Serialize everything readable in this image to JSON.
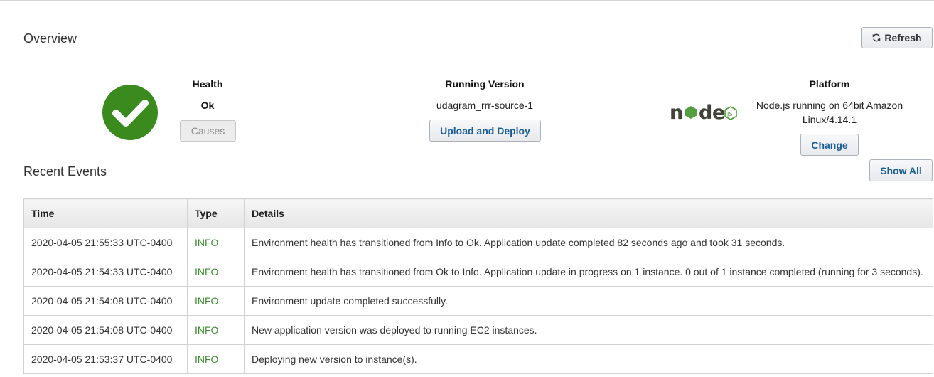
{
  "overview": {
    "title": "Overview",
    "refresh_label": "Refresh"
  },
  "health": {
    "heading": "Health",
    "status": "Ok",
    "causes_label": "Causes",
    "color": "#3b8a1e"
  },
  "running_version": {
    "heading": "Running Version",
    "value": "udagram_rrr-source-1",
    "upload_deploy_label": "Upload and Deploy"
  },
  "platform": {
    "heading": "Platform",
    "logo": "nodejs-logo",
    "description_line1": "Node.js running on 64bit Amazon",
    "description_line2": "Linux/4.14.1",
    "change_label": "Change"
  },
  "recent_events": {
    "title": "Recent Events",
    "show_all_label": "Show All",
    "columns": [
      "Time",
      "Type",
      "Details"
    ],
    "rows": [
      {
        "time": "2020-04-05 21:55:33 UTC-0400",
        "type": "INFO",
        "details": "Environment health has transitioned from Info to Ok. Application update completed 82 seconds ago and took 31 seconds."
      },
      {
        "time": "2020-04-05 21:54:33 UTC-0400",
        "type": "INFO",
        "details": "Environment health has transitioned from Ok to Info. Application update in progress on 1 instance. 0 out of 1 instance completed (running for 3 seconds)."
      },
      {
        "time": "2020-04-05 21:54:08 UTC-0400",
        "type": "INFO",
        "details": "Environment update completed successfully."
      },
      {
        "time": "2020-04-05 21:54:08 UTC-0400",
        "type": "INFO",
        "details": "New application version was deployed to running EC2 instances."
      },
      {
        "time": "2020-04-05 21:53:37 UTC-0400",
        "type": "INFO",
        "details": "Deploying new version to instance(s)."
      }
    ],
    "info_color": "#3c8d2f"
  }
}
